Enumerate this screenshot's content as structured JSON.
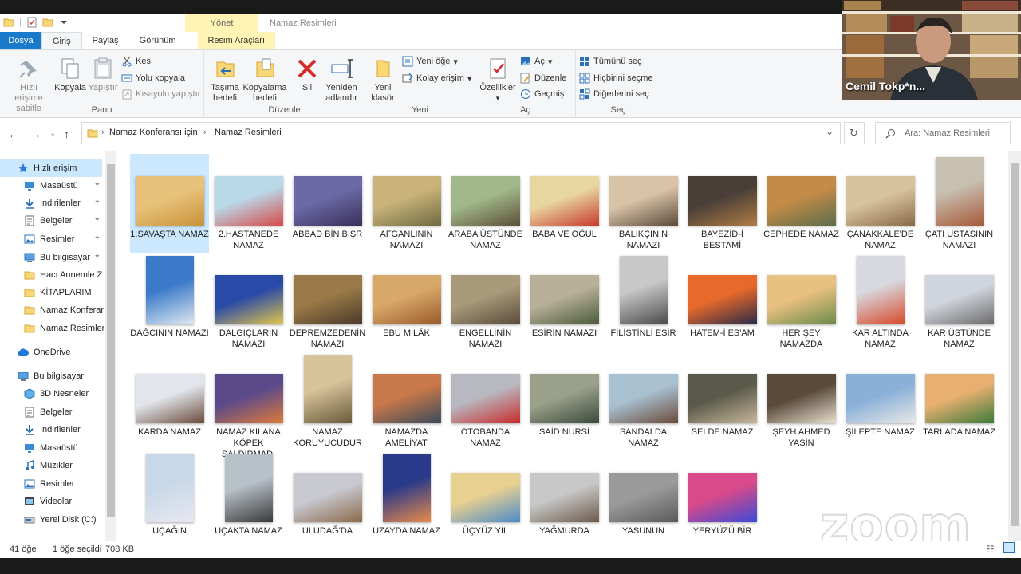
{
  "window": {
    "title": "Namaz Resimleri",
    "manage_tab": "Yönet"
  },
  "tabs": [
    "Dosya",
    "Giriş",
    "Paylaş",
    "Görünüm",
    "Resim Araçları"
  ],
  "ribbon": {
    "pano": {
      "label": "Pano",
      "pin": "Hızlı erişime sabitle",
      "copy": "Kopyala",
      "paste": "Yapıştır",
      "cut": "Kes",
      "copy_path": "Yolu kopyala",
      "paste_shortcut": "Kısayolu yapıştır"
    },
    "duzenle": {
      "label": "Düzenle",
      "move": "Taşıma hedefi",
      "copyto": "Kopyalama hedefi",
      "delete": "Sil",
      "rename": "Yeniden adlandır"
    },
    "yeni": {
      "label": "Yeni",
      "new_folder": "Yeni klasör",
      "new_item": "Yeni öğe",
      "easy_access": "Kolay erişim"
    },
    "ac": {
      "label": "Aç",
      "props": "Özellikler",
      "open": "Aç",
      "edit": "Düzenle",
      "history": "Geçmiş"
    },
    "sec": {
      "label": "Seç",
      "all": "Tümünü seç",
      "none": "Hiçbirini seçme",
      "invert": "Diğerlerini seç"
    }
  },
  "webcam": {
    "name": "Cemil Tokp*n..."
  },
  "address": {
    "crumbs": [
      "Namaz Konferansı için",
      "Namaz Resimleri"
    ],
    "search_placeholder": "Ara: Namaz Resimleri"
  },
  "sidebar": [
    {
      "label": "Hızlı erişim",
      "icon": "star-icon",
      "level": 0
    },
    {
      "label": "Masaüstü",
      "icon": "desktop-icon",
      "level": 1,
      "pinned": true
    },
    {
      "label": "İndirilenler",
      "icon": "download-icon",
      "level": 1,
      "pinned": true
    },
    {
      "label": "Belgeler",
      "icon": "documents-icon",
      "level": 1,
      "pinned": true
    },
    {
      "label": "Resimler",
      "icon": "pictures-icon",
      "level": 1,
      "pinned": true
    },
    {
      "label": "Bu bilgisayar",
      "icon": "computer-icon",
      "level": 1,
      "pinned": true
    },
    {
      "label": "Hacı Annemle Z",
      "icon": "folder-icon",
      "level": 1
    },
    {
      "label": "KİTAPLARIM",
      "icon": "folder-icon",
      "level": 1
    },
    {
      "label": "Namaz Konferan",
      "icon": "folder-icon",
      "level": 1
    },
    {
      "label": "Namaz Resimleri",
      "icon": "folder-icon",
      "level": 1
    },
    {
      "label": "OneDrive",
      "icon": "cloud-icon",
      "level": 0
    },
    {
      "label": "Bu bilgisayar",
      "icon": "computer-icon",
      "level": 0
    },
    {
      "label": "3D Nesneler",
      "icon": "cube-icon",
      "level": 1
    },
    {
      "label": "Belgeler",
      "icon": "documents-icon",
      "level": 1
    },
    {
      "label": "İndirilenler",
      "icon": "download-icon",
      "level": 1
    },
    {
      "label": "Masaüstü",
      "icon": "desktop-icon",
      "level": 1
    },
    {
      "label": "Müzikler",
      "icon": "music-icon",
      "level": 1
    },
    {
      "label": "Resimler",
      "icon": "pictures-icon",
      "level": 1
    },
    {
      "label": "Videolar",
      "icon": "video-icon",
      "level": 1
    },
    {
      "label": "Yerel Disk (C:)",
      "icon": "disk-icon",
      "level": 1
    }
  ],
  "files": [
    {
      "name": "1.SAVAŞTA NAMAZ",
      "selected": true,
      "colors": [
        "#e8c27a",
        "#c8923a"
      ]
    },
    {
      "name": "2.HASTANEDE NAMAZ",
      "colors": [
        "#b9d8e8",
        "#d64a4a"
      ]
    },
    {
      "name": "ABBAD BİN BİŞR",
      "colors": [
        "#6b6aa6",
        "#3a2f5a"
      ]
    },
    {
      "name": "AFGANLININ NAMAZI",
      "colors": [
        "#c9b37a",
        "#6f6a3f"
      ]
    },
    {
      "name": "ARABA ÜSTÜNDE NAMAZ",
      "colors": [
        "#a0b88a",
        "#5d5038"
      ]
    },
    {
      "name": "BABA VE OĞUL",
      "colors": [
        "#e8d6a0",
        "#c83a2e"
      ]
    },
    {
      "name": "BALIKÇININ NAMAZI",
      "colors": [
        "#d8c3a8",
        "#5e4a3a"
      ]
    },
    {
      "name": "BAYEZİD-İ BESTAMİ",
      "colors": [
        "#4a3f38",
        "#b07c45"
      ]
    },
    {
      "name": "CEPHEDE NAMAZ",
      "colors": [
        "#c48a48",
        "#5a6e4a"
      ]
    },
    {
      "name": "ÇANAKKALE'DE NAMAZ",
      "colors": [
        "#d8c49c",
        "#8a6a48"
      ]
    },
    {
      "name": "ÇATI USTASININ NAMAZI",
      "colors": [
        "#c7bfb0",
        "#a65a3a"
      ]
    },
    {
      "name": "DAĞCININ NAMAZI",
      "colors": [
        "#3a7ac8",
        "#dfe8f2"
      ]
    },
    {
      "name": "DALGIÇLARIN NAMAZI",
      "colors": [
        "#2a4aa8",
        "#e2c64a"
      ]
    },
    {
      "name": "DEPREMZEDENİN NAMAZI",
      "colors": [
        "#9a7a48",
        "#4a3a2a"
      ]
    },
    {
      "name": "EBU MİLÂK",
      "colors": [
        "#d8a868",
        "#9a5a2a"
      ]
    },
    {
      "name": "ENGELLİNİN NAMAZI",
      "colors": [
        "#a89a7a",
        "#5a4a3a"
      ]
    },
    {
      "name": "ESİRİN NAMAZI",
      "colors": [
        "#b8b098",
        "#4a5a3a"
      ]
    },
    {
      "name": "FİLİSTİNLİ ESİR",
      "colors": [
        "#c8c8c8",
        "#4a4a4a"
      ]
    },
    {
      "name": "HATEM-İ ES'AM",
      "colors": [
        "#e86a2a",
        "#2a2a48"
      ]
    },
    {
      "name": "HER ŞEY NAMAZDA",
      "colors": [
        "#e8c080",
        "#6a8a4a"
      ]
    },
    {
      "name": "KAR ALTINDA NAMAZ",
      "colors": [
        "#d8d8e0",
        "#d84a2a"
      ]
    },
    {
      "name": "KAR ÜSTÜNDE NAMAZ",
      "colors": [
        "#d0d4dc",
        "#6a6a6a"
      ]
    },
    {
      "name": "KARDA NAMAZ",
      "colors": [
        "#e2e6ec",
        "#6a4a3a"
      ]
    },
    {
      "name": "NAMAZ KILANA KÖPEK SALDIRMADI",
      "colors": [
        "#5a4a8a",
        "#e07a3a"
      ]
    },
    {
      "name": "NAMAZ KORUYUCUDUR",
      "colors": [
        "#d8c49a",
        "#6a5a3a"
      ]
    },
    {
      "name": "NAMAZDA AMELİYAT",
      "colors": [
        "#c8784a",
        "#3a4a5a"
      ]
    },
    {
      "name": "OTOBANDA NAMAZ",
      "colors": [
        "#b8b8c0",
        "#c82a2a"
      ]
    },
    {
      "name": "SAİD NURSİ",
      "colors": [
        "#9aa08a",
        "#3a4a3a"
      ]
    },
    {
      "name": "SANDALDA NAMAZ",
      "colors": [
        "#a8c0d0",
        "#6a4a3a"
      ]
    },
    {
      "name": "SELDE NAMAZ",
      "colors": [
        "#5a5a4a",
        "#c8b89a"
      ]
    },
    {
      "name": "ŞEYH AHMED YASİN",
      "colors": [
        "#5a4a3a",
        "#e8e0d0"
      ]
    },
    {
      "name": "ŞİLEPTE NAMAZ",
      "colors": [
        "#8ab0d8",
        "#e8e8e8"
      ]
    },
    {
      "name": "TARLADA NAMAZ",
      "colors": [
        "#e8b070",
        "#3a7a3a"
      ]
    },
    {
      "name": "UÇAĞIN",
      "colors": [
        "#c8d8e8",
        "#e8e8f0"
      ]
    },
    {
      "name": "UÇAKTA NAMAZ",
      "colors": [
        "#b8c0c8",
        "#3a3a3a"
      ]
    },
    {
      "name": "ULUDAĞ'DA",
      "colors": [
        "#c8c8d0",
        "#8a6a4a"
      ]
    },
    {
      "name": "UZAYDA NAMAZ",
      "colors": [
        "#2a3a8a",
        "#e88a4a"
      ]
    },
    {
      "name": "ÜÇYÜZ YIL",
      "colors": [
        "#e8d090",
        "#4a8ac8"
      ]
    },
    {
      "name": "YAĞMURDA",
      "colors": [
        "#c8c8c8",
        "#6a5a4a"
      ]
    },
    {
      "name": "YASUNUN",
      "colors": [
        "#9a9a9a",
        "#5a5a5a"
      ]
    },
    {
      "name": "YERYÜZÜ BİR",
      "colors": [
        "#d84a8a",
        "#3a4ad8"
      ]
    }
  ],
  "status": {
    "count": "41 öğe",
    "selection": "1 öğe seçildi",
    "size": "708 KB"
  },
  "watermark": "zoom"
}
